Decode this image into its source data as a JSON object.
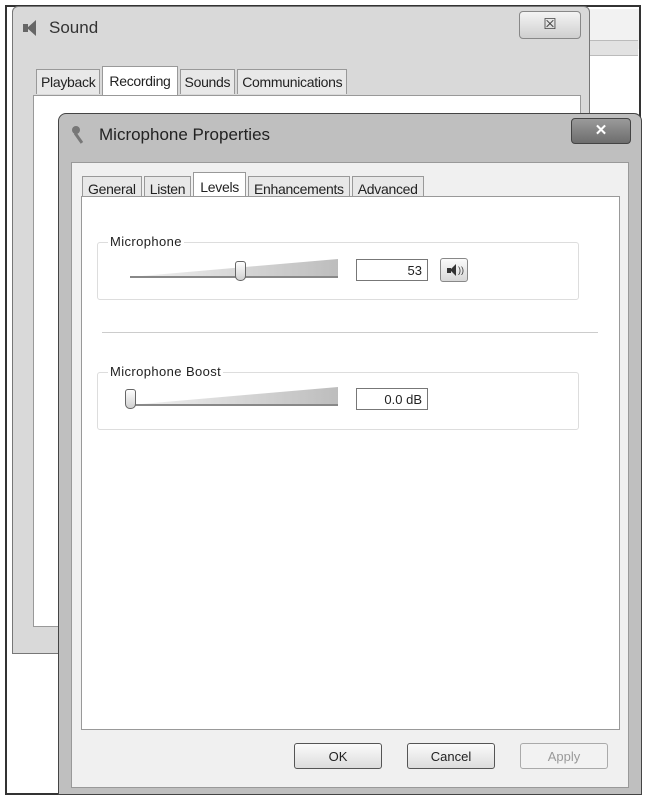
{
  "sound_window": {
    "title": "Sound",
    "close_label": "☒",
    "tabs": [
      "Playback",
      "Recording",
      "Sounds",
      "Communications"
    ],
    "active_tab": "Recording"
  },
  "dialog": {
    "title": "Microphone Properties",
    "close_label": "✕",
    "tabs": [
      "General",
      "Listen",
      "Levels",
      "Enhancements",
      "Advanced"
    ],
    "active_tab": "Levels",
    "microphone": {
      "label": "Microphone",
      "value": "53",
      "level": 0.53
    },
    "boost": {
      "label": "Microphone Boost",
      "value": "0.0 dB",
      "level": 0.0
    },
    "buttons": {
      "ok": "OK",
      "cancel": "Cancel",
      "apply": "Apply"
    }
  },
  "icons": {
    "sound": "speaker-icon",
    "microphone": "microphone-icon",
    "mute": "speaker-volume-icon"
  }
}
